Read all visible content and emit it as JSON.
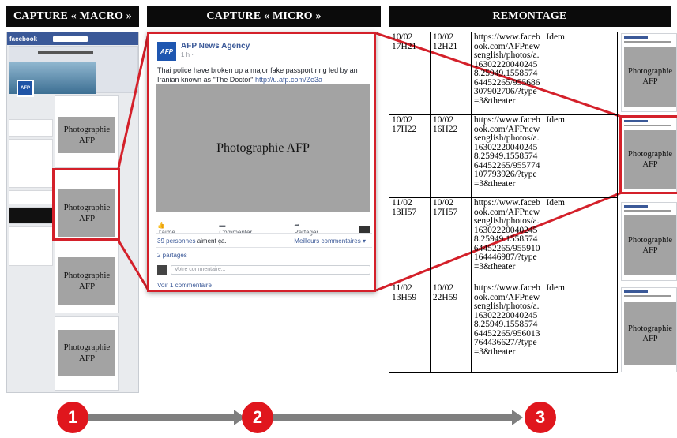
{
  "headers": {
    "macro": "CAPTURE « MACRO »",
    "micro": "CAPTURE « MICRO »",
    "remontage": "REMONTAGE"
  },
  "macro": {
    "fb_logo": "facebook",
    "photos": [
      "Photographie AFP",
      "Photographie AFP",
      "Photographie AFP",
      "Photographie AFP"
    ]
  },
  "micro": {
    "logo": "AFP",
    "page_name": "AFP News Agency",
    "time": "1 h · ",
    "text": "Thai police have broken up a major fake passport ring led by an Iranian known as \"The Doctor\" ",
    "link": "http://u.afp.com/Ze3a",
    "photo": "Photographie AFP",
    "like": "J'aime",
    "comment": "Commenter",
    "share": "Partager",
    "likes_count": "39 personnes",
    "likes_suffix": " aiment ça.",
    "best_comments": "Meilleurs commentaires ▾",
    "shares": "2 partages",
    "comment_placeholder": "Votre commentaire...",
    "view_comments": "Voir 1 commentaire"
  },
  "table": [
    {
      "d1": "10/02 17H21",
      "d2": "10/02 12H21",
      "url": "https://www.facebook.com/AFPnewsenglish/photos/a.163022200402458.25949.155857464452265/955686307902706/?type=3&theater",
      "note": "Idem"
    },
    {
      "d1": "10/02 17H22",
      "d2": "10/02 16H22",
      "url": "https://www.facebook.com/AFPnewsenglish/photos/a.163022200402458.25949.155857464452265/955774107793926/?type=3&theater",
      "note": "Idem"
    },
    {
      "d1": "11/02 13H57",
      "d2": "10/02 17H57",
      "url": "https://www.facebook.com/AFPnewsenglish/photos/a.163022200402458.25949.155857464452265/955910164446987/?type=3&theater",
      "note": "Idem"
    },
    {
      "d1": "11/02 13H59",
      "d2": "10/02 22H59",
      "url": "https://www.facebook.com/AFPnewsenglish/photos/a.163022200402458.25949.155857464452265/956013764436627/?type=3&theater",
      "note": "Idem"
    }
  ],
  "thumbs": [
    "Photographie AFP",
    "Photographie AFP",
    "Photographie AFP",
    "Photographie AFP"
  ],
  "steps": [
    "1",
    "2",
    "3"
  ],
  "colors": {
    "accent_red": "#d4202a",
    "facebook_blue": "#3b5998",
    "photo_gray": "#a3a3a3",
    "arrow_gray": "#7f7f7f"
  }
}
